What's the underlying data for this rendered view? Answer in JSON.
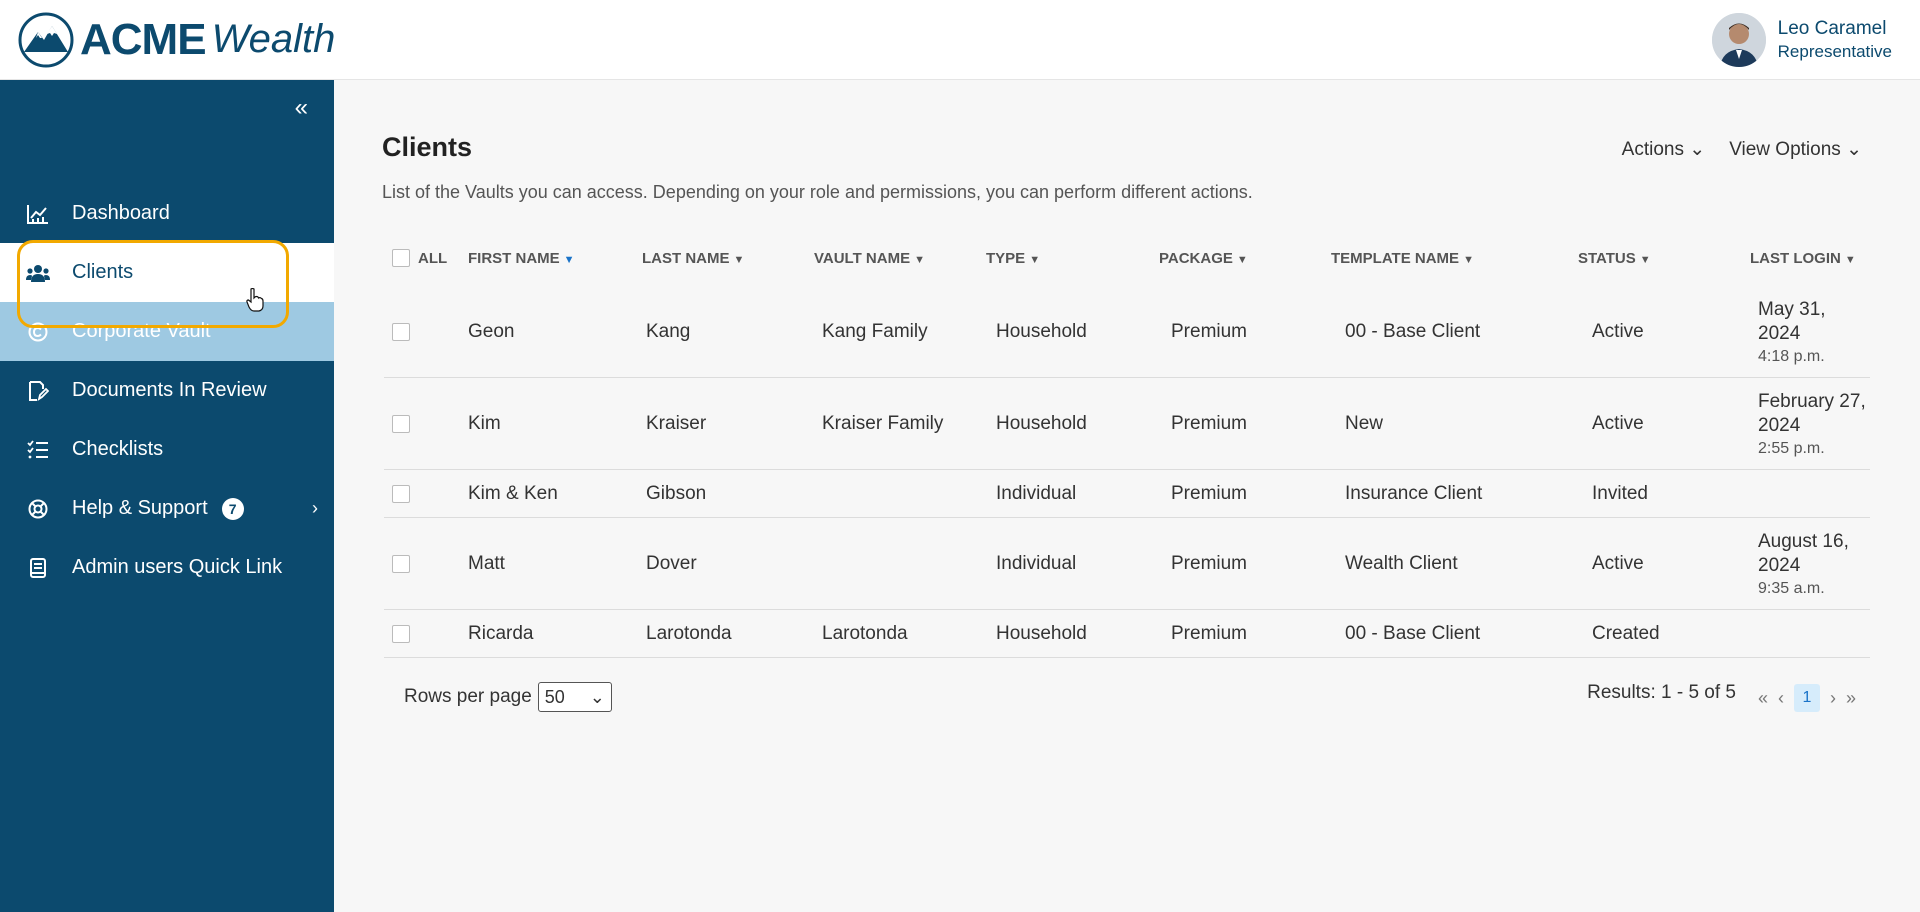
{
  "header": {
    "logo_acme": "ACME",
    "logo_wealth": "Wealth",
    "user_name": "Leo Caramel",
    "user_role": "Representative"
  },
  "sidebar": {
    "items": [
      {
        "label": "Dashboard",
        "icon": "chart-icon"
      },
      {
        "label": "Clients",
        "icon": "users-icon"
      },
      {
        "label": "Corporate Vault",
        "icon": "copyright-icon"
      },
      {
        "label": "Documents In Review",
        "icon": "edit-document-icon"
      },
      {
        "label": "Checklists",
        "icon": "checklist-icon"
      },
      {
        "label": "Help & Support",
        "icon": "lifebuoy-icon",
        "badge": "7"
      },
      {
        "label": "Admin users Quick Link",
        "icon": "book-icon"
      }
    ],
    "active": "Clients",
    "hovered": "Corporate Vault"
  },
  "main": {
    "title": "Clients",
    "description": "List of the Vaults you can access. Depending on your role and permissions, you can perform different actions.",
    "actions_label": "Actions",
    "view_options_label": "View Options",
    "columns": {
      "all": "ALL",
      "first_name": "FIRST NAME",
      "last_name": "LAST NAME",
      "vault_name": "VAULT NAME",
      "type": "TYPE",
      "package": "PACKAGE",
      "template_name": "TEMPLATE NAME",
      "status": "STATUS",
      "last_login": "LAST LOGIN"
    },
    "rows": [
      {
        "first": "Geon",
        "last": "Kang",
        "vault": "Kang Family",
        "type": "Household",
        "package": "Premium",
        "template": "00 - Base Client",
        "status": "Active",
        "login_date": "May 31, 2024",
        "login_time": "4:18 p.m."
      },
      {
        "first": "Kim",
        "last": "Kraiser",
        "vault": "Kraiser Family",
        "type": "Household",
        "package": "Premium",
        "template": "New",
        "status": "Active",
        "login_date": "February 27, 2024",
        "login_time": "2:55 p.m."
      },
      {
        "first": "Kim & Ken",
        "last": "Gibson",
        "vault": "",
        "type": "Individual",
        "package": "Premium",
        "template": "Insurance Client",
        "status": "Invited",
        "login_date": "",
        "login_time": ""
      },
      {
        "first": "Matt",
        "last": "Dover",
        "vault": "",
        "type": "Individual",
        "package": "Premium",
        "template": "Wealth Client",
        "status": "Active",
        "login_date": "August 16, 2024",
        "login_time": "9:35 a.m."
      },
      {
        "first": "Ricarda",
        "last": "Larotonda",
        "vault": "Larotonda",
        "type": "Household",
        "package": "Premium",
        "template": "00 - Base Client",
        "status": "Created",
        "login_date": "",
        "login_time": ""
      }
    ],
    "footer": {
      "rows_per_page_label": "Rows per page",
      "rows_per_page_value": "50",
      "results": "Results: 1 - 5 of 5",
      "current_page": "1"
    }
  },
  "colors": {
    "brand": "#0c4a6e",
    "hover": "#9ec9e2",
    "highlight": "#f2a900",
    "sort_active": "#1a73c8"
  }
}
